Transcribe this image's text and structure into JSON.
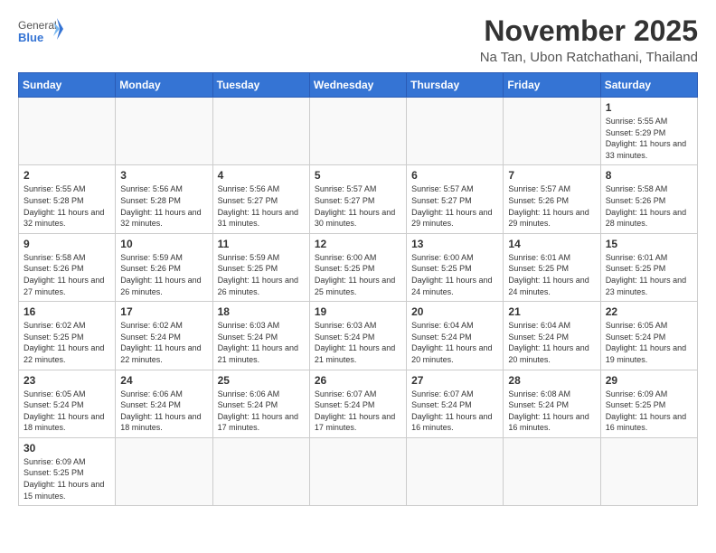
{
  "header": {
    "logo_general": "General",
    "logo_blue": "Blue",
    "month_title": "November 2025",
    "location": "Na Tan, Ubon Ratchathani, Thailand"
  },
  "weekdays": [
    "Sunday",
    "Monday",
    "Tuesday",
    "Wednesday",
    "Thursday",
    "Friday",
    "Saturday"
  ],
  "days": {
    "d1": {
      "num": "1",
      "sunrise": "5:55 AM",
      "sunset": "5:29 PM",
      "daylight": "11 hours and 33 minutes."
    },
    "d2": {
      "num": "2",
      "sunrise": "5:55 AM",
      "sunset": "5:28 PM",
      "daylight": "11 hours and 32 minutes."
    },
    "d3": {
      "num": "3",
      "sunrise": "5:56 AM",
      "sunset": "5:28 PM",
      "daylight": "11 hours and 32 minutes."
    },
    "d4": {
      "num": "4",
      "sunrise": "5:56 AM",
      "sunset": "5:27 PM",
      "daylight": "11 hours and 31 minutes."
    },
    "d5": {
      "num": "5",
      "sunrise": "5:57 AM",
      "sunset": "5:27 PM",
      "daylight": "11 hours and 30 minutes."
    },
    "d6": {
      "num": "6",
      "sunrise": "5:57 AM",
      "sunset": "5:27 PM",
      "daylight": "11 hours and 29 minutes."
    },
    "d7": {
      "num": "7",
      "sunrise": "5:57 AM",
      "sunset": "5:26 PM",
      "daylight": "11 hours and 29 minutes."
    },
    "d8": {
      "num": "8",
      "sunrise": "5:58 AM",
      "sunset": "5:26 PM",
      "daylight": "11 hours and 28 minutes."
    },
    "d9": {
      "num": "9",
      "sunrise": "5:58 AM",
      "sunset": "5:26 PM",
      "daylight": "11 hours and 27 minutes."
    },
    "d10": {
      "num": "10",
      "sunrise": "5:59 AM",
      "sunset": "5:26 PM",
      "daylight": "11 hours and 26 minutes."
    },
    "d11": {
      "num": "11",
      "sunrise": "5:59 AM",
      "sunset": "5:25 PM",
      "daylight": "11 hours and 26 minutes."
    },
    "d12": {
      "num": "12",
      "sunrise": "6:00 AM",
      "sunset": "5:25 PM",
      "daylight": "11 hours and 25 minutes."
    },
    "d13": {
      "num": "13",
      "sunrise": "6:00 AM",
      "sunset": "5:25 PM",
      "daylight": "11 hours and 24 minutes."
    },
    "d14": {
      "num": "14",
      "sunrise": "6:01 AM",
      "sunset": "5:25 PM",
      "daylight": "11 hours and 24 minutes."
    },
    "d15": {
      "num": "15",
      "sunrise": "6:01 AM",
      "sunset": "5:25 PM",
      "daylight": "11 hours and 23 minutes."
    },
    "d16": {
      "num": "16",
      "sunrise": "6:02 AM",
      "sunset": "5:25 PM",
      "daylight": "11 hours and 22 minutes."
    },
    "d17": {
      "num": "17",
      "sunrise": "6:02 AM",
      "sunset": "5:24 PM",
      "daylight": "11 hours and 22 minutes."
    },
    "d18": {
      "num": "18",
      "sunrise": "6:03 AM",
      "sunset": "5:24 PM",
      "daylight": "11 hours and 21 minutes."
    },
    "d19": {
      "num": "19",
      "sunrise": "6:03 AM",
      "sunset": "5:24 PM",
      "daylight": "11 hours and 21 minutes."
    },
    "d20": {
      "num": "20",
      "sunrise": "6:04 AM",
      "sunset": "5:24 PM",
      "daylight": "11 hours and 20 minutes."
    },
    "d21": {
      "num": "21",
      "sunrise": "6:04 AM",
      "sunset": "5:24 PM",
      "daylight": "11 hours and 20 minutes."
    },
    "d22": {
      "num": "22",
      "sunrise": "6:05 AM",
      "sunset": "5:24 PM",
      "daylight": "11 hours and 19 minutes."
    },
    "d23": {
      "num": "23",
      "sunrise": "6:05 AM",
      "sunset": "5:24 PM",
      "daylight": "11 hours and 18 minutes."
    },
    "d24": {
      "num": "24",
      "sunrise": "6:06 AM",
      "sunset": "5:24 PM",
      "daylight": "11 hours and 18 minutes."
    },
    "d25": {
      "num": "25",
      "sunrise": "6:06 AM",
      "sunset": "5:24 PM",
      "daylight": "11 hours and 17 minutes."
    },
    "d26": {
      "num": "26",
      "sunrise": "6:07 AM",
      "sunset": "5:24 PM",
      "daylight": "11 hours and 17 minutes."
    },
    "d27": {
      "num": "27",
      "sunrise": "6:07 AM",
      "sunset": "5:24 PM",
      "daylight": "11 hours and 16 minutes."
    },
    "d28": {
      "num": "28",
      "sunrise": "6:08 AM",
      "sunset": "5:24 PM",
      "daylight": "11 hours and 16 minutes."
    },
    "d29": {
      "num": "29",
      "sunrise": "6:09 AM",
      "sunset": "5:25 PM",
      "daylight": "11 hours and 16 minutes."
    },
    "d30": {
      "num": "30",
      "sunrise": "6:09 AM",
      "sunset": "5:25 PM",
      "daylight": "11 hours and 15 minutes."
    }
  },
  "labels": {
    "sunrise": "Sunrise:",
    "sunset": "Sunset:",
    "daylight": "Daylight:"
  }
}
